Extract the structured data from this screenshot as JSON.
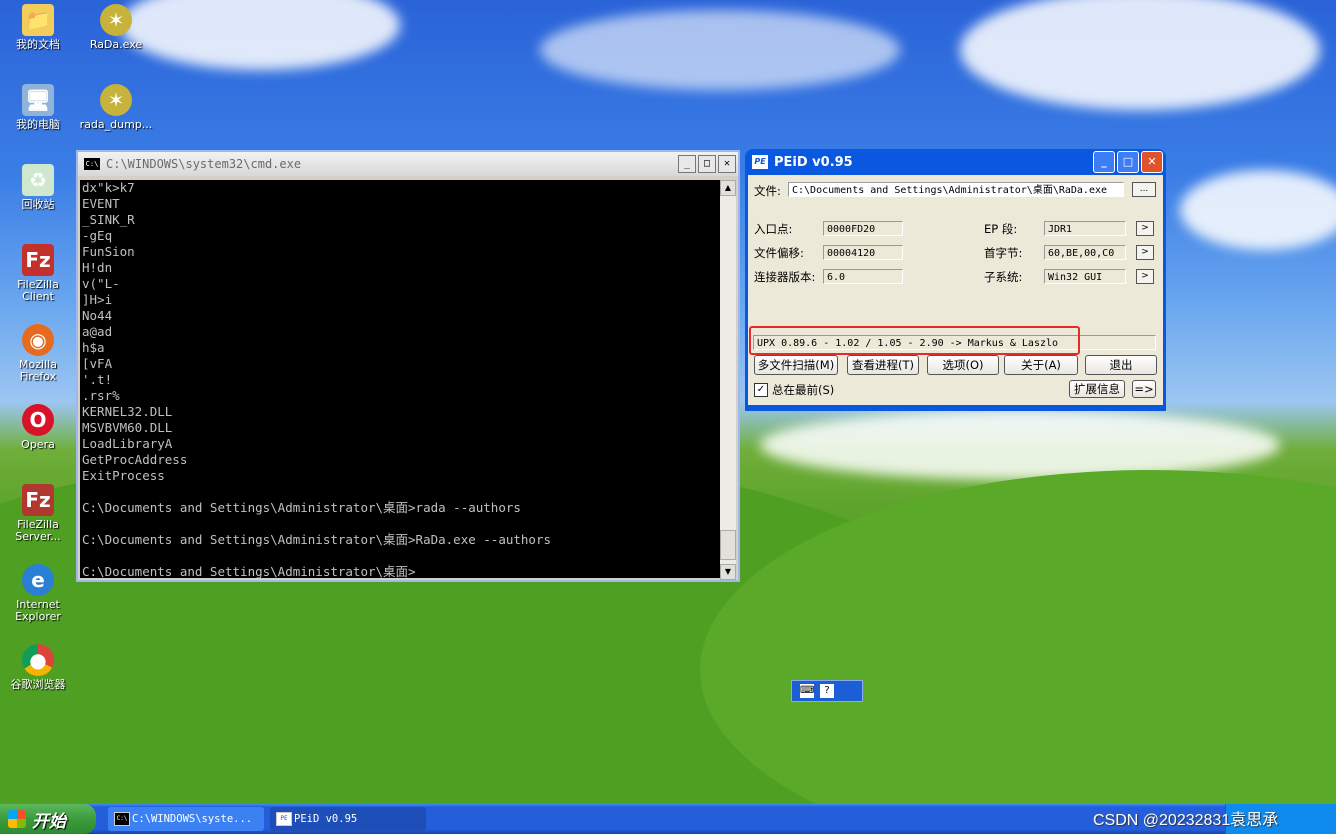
{
  "desktop_icons": [
    {
      "label": "我的文档",
      "icon": "folder-icon"
    },
    {
      "label": "RaDa.exe",
      "icon": "pufferfish-icon"
    },
    {
      "label": "我的电脑",
      "icon": "computer-icon"
    },
    {
      "label": "rada_dump...",
      "icon": "pufferfish-icon"
    },
    {
      "label": "回收站",
      "icon": "recycle-bin-icon"
    },
    {
      "label": "FileZilla Client",
      "icon": "filezilla-icon"
    },
    {
      "label": "Mozilla Firefox",
      "icon": "firefox-icon"
    },
    {
      "label": "Opera",
      "icon": "opera-icon"
    },
    {
      "label": "FileZilla Server...",
      "icon": "filezilla-icon"
    },
    {
      "label": "Internet Explorer",
      "icon": "ie-icon"
    },
    {
      "label": "谷歌浏览器",
      "icon": "chrome-icon"
    }
  ],
  "cmd": {
    "title": "C:\\WINDOWS\\system32\\cmd.exe",
    "lines": [
      "dx\"k>k7",
      "EVENT",
      "_SINK_R",
      "-gEq",
      "FunSion",
      "H!dn",
      "v(\"L-",
      "]H>i",
      "No44",
      "a@ad",
      "h$a",
      "[vFA",
      "'.t!",
      ".rsr%",
      "KERNEL32.DLL",
      "MSVBVM60.DLL",
      "LoadLibraryA",
      "GetProcAddress",
      "ExitProcess",
      "",
      "C:\\Documents and Settings\\Administrator\\桌面>rada --authors",
      "",
      "C:\\Documents and Settings\\Administrator\\桌面>RaDa.exe --authors",
      "",
      "C:\\Documents and Settings\\Administrator\\桌面>"
    ]
  },
  "peid": {
    "title": "PEiD v0.95",
    "file_label": "文件:",
    "file_value": "C:\\Documents and Settings\\Administrator\\桌面\\RaDa.exe",
    "browse_label": "...",
    "entry_label": "入口点:",
    "entry_value": "0000FD20",
    "ep_section_label": "EP 段:",
    "ep_section_value": "JDR1",
    "offset_label": "文件偏移:",
    "offset_value": "00004120",
    "first_bytes_label": "首字节:",
    "first_bytes_value": "60,BE,00,C0",
    "linker_label": "连接器版本:",
    "linker_value": "6.0",
    "subsystem_label": "子系统:",
    "subsystem_value": "Win32 GUI",
    "arrow": ">",
    "detection": "UPX 0.89.6 - 1.02 / 1.05 - 2.90 -> Markus & Laszlo",
    "buttons": [
      "多文件扫描(M)",
      "查看进程(T)",
      "选项(O)",
      "关于(A)",
      "退出"
    ],
    "always_on_top_label": "总在最前(S)",
    "always_on_top_checked": true,
    "ext_info_label": "扩展信息",
    "more_label": "=>"
  },
  "taskbar": {
    "start_label": "开始",
    "tasks": [
      "C:\\WINDOWS\\syste...",
      "PEiD v0.95"
    ]
  },
  "watermark": "CSDN @20232831袁思承"
}
